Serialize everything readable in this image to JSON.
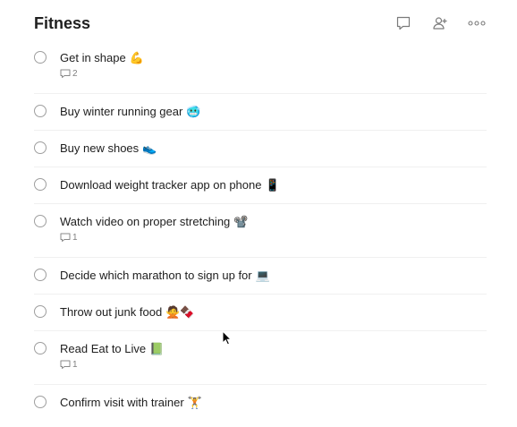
{
  "project": {
    "title": "Fitness"
  },
  "header_actions": [
    {
      "name": "comments-button",
      "icon": "comment-icon"
    },
    {
      "name": "share-button",
      "icon": "add-person-icon"
    },
    {
      "name": "more-button",
      "icon": "more-icon"
    }
  ],
  "tasks": [
    {
      "text": "Get in shape",
      "emoji": "💪",
      "comments": "2"
    },
    {
      "text": "Buy winter running gear",
      "emoji": "🥶"
    },
    {
      "text": "Buy new shoes",
      "emoji": "👟"
    },
    {
      "text": "Download weight tracker app on phone",
      "emoji": "📱"
    },
    {
      "text": "Watch video on proper stretching",
      "emoji": "📽️",
      "comments": "1"
    },
    {
      "text": "Decide which marathon to sign up for",
      "emoji": "💻"
    },
    {
      "text": "Throw out junk food",
      "emoji": "🙅🍫"
    },
    {
      "text": "Read Eat to Live",
      "emoji": "📗",
      "comments": "1"
    },
    {
      "text": "Confirm visit with trainer",
      "emoji": "🏋️"
    }
  ]
}
